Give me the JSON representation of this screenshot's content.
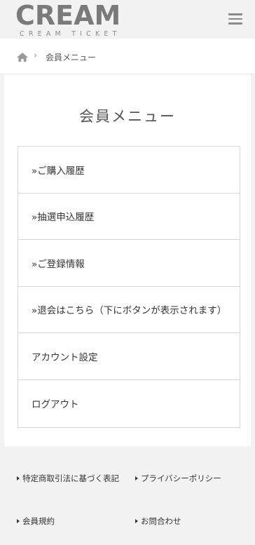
{
  "header": {
    "logo_main": "CREAM",
    "logo_sub": "CREAM TICKET",
    "menu_icon": "hamburger-menu-icon"
  },
  "breadcrumb": {
    "home_icon": "home-icon",
    "separator": "›",
    "current": "会員メニュー"
  },
  "main": {
    "title": "会員メニュー",
    "menu_items": [
      {
        "label": "»ご購入履歴"
      },
      {
        "label": "»抽選申込履歴"
      },
      {
        "label": "»ご登録情報"
      },
      {
        "label": "»退会はこちら（下にボタンが表示されます）"
      },
      {
        "label": "アカウント設定"
      },
      {
        "label": "ログアウト"
      }
    ]
  },
  "footer": {
    "links": [
      {
        "label": "特定商取引法に基づく表記"
      },
      {
        "label": "プライバシーポリシー"
      },
      {
        "label": "会員規約"
      },
      {
        "label": "お問合わせ"
      }
    ]
  },
  "colors": {
    "background": "#f2f2f2",
    "logo": "#7a7a7a",
    "border": "#d6d6d6",
    "text": "#333333"
  }
}
